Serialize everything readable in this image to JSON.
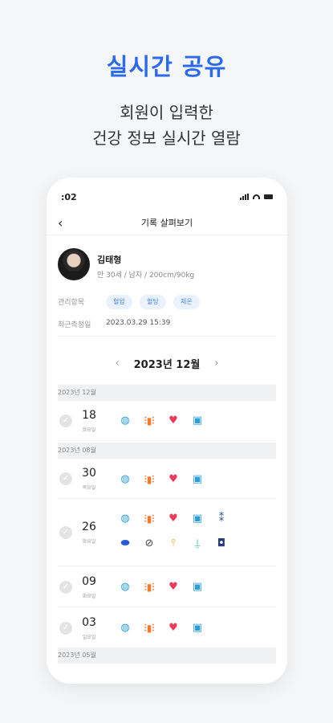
{
  "hero": {
    "title": "실시간 공유",
    "subtitle_line1": "회원이 입력한",
    "subtitle_line2": "건강 정보 실시간 열람"
  },
  "status_bar": {
    "time": ":02"
  },
  "nav": {
    "title": "기록 살펴보기"
  },
  "profile": {
    "name": "김태형",
    "info": "만 30세 / 남자 / 200cm/90kg",
    "manage_label": "관리항목",
    "tags": [
      "혈압",
      "혈당",
      "체온"
    ],
    "last_measured_label": "최근측정일",
    "last_measured_value": "2023.03.29 15:39"
  },
  "month_nav": {
    "prev": "‹",
    "label": "2023년 12월",
    "next": "›"
  },
  "sections": [
    {
      "header": "2023년 12월"
    },
    {
      "header": "2023년 08월"
    },
    {
      "header": "2023년 05월"
    }
  ],
  "entries": [
    {
      "day": "18",
      "dow": "화요일",
      "icons": [
        "water-icon",
        "dumbbell-icon",
        "heart-icon",
        "scale-icon"
      ]
    },
    {
      "day": "30",
      "dow": "목요일",
      "icons": [
        "water-icon",
        "dumbbell-icon",
        "heart-icon",
        "scale-icon"
      ]
    },
    {
      "day": "26",
      "dow": "화요일",
      "icons": [
        "water-icon",
        "dumbbell-icon",
        "heart-icon",
        "scale-icon",
        "footsteps-icon",
        "pill-icon",
        "cigarette-icon",
        "thermometer-icon",
        "bottle-icon",
        "meal-icon"
      ]
    },
    {
      "day": "09",
      "dow": "화요일",
      "icons": [
        "water-icon",
        "dumbbell-icon",
        "heart-icon",
        "scale-icon"
      ]
    },
    {
      "day": "03",
      "dow": "일요일",
      "icons": [
        "water-icon",
        "dumbbell-icon",
        "heart-icon",
        "scale-icon"
      ]
    }
  ],
  "colors": {
    "accent": "#2b6be9",
    "tag_bg": "#eaf2fd",
    "tag_text": "#4a86ea"
  }
}
